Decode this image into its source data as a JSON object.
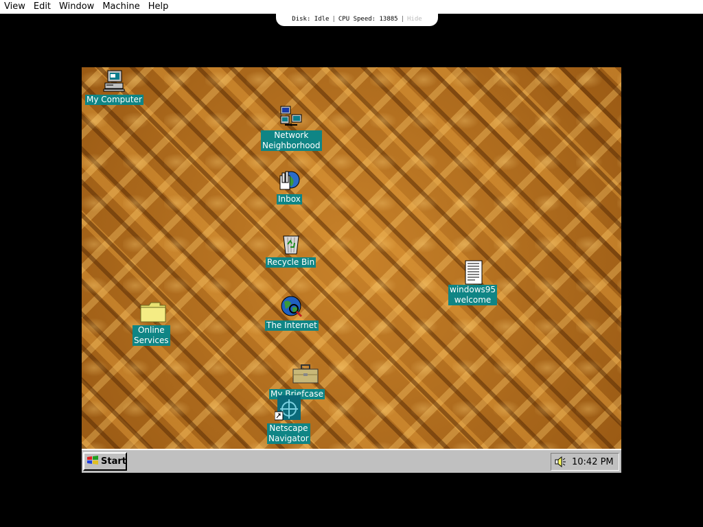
{
  "host_menu": {
    "items": [
      "View",
      "Edit",
      "Window",
      "Machine",
      "Help"
    ]
  },
  "status_bar": {
    "disk": "Disk: Idle",
    "cpu": "CPU Speed: 13885",
    "hide": "Hide"
  },
  "desktop": {
    "icons": {
      "my_computer": "My Computer",
      "network_neighborhood": "Network\nNeighborhood",
      "inbox": "Inbox",
      "recycle_bin": "Recycle Bin",
      "the_internet": "The Internet",
      "my_briefcase": "My Briefcase",
      "netscape": "Netscape\nNavigator",
      "online_services": "Online\nServices",
      "windows95_welcome": "windows95\nwelcome"
    }
  },
  "taskbar": {
    "start_label": "Start",
    "clock": "10:42 PM"
  },
  "colors": {
    "desktop_base": "#b8721c",
    "label_bg": "#0f8585",
    "taskbar": "#c0c0c0"
  }
}
